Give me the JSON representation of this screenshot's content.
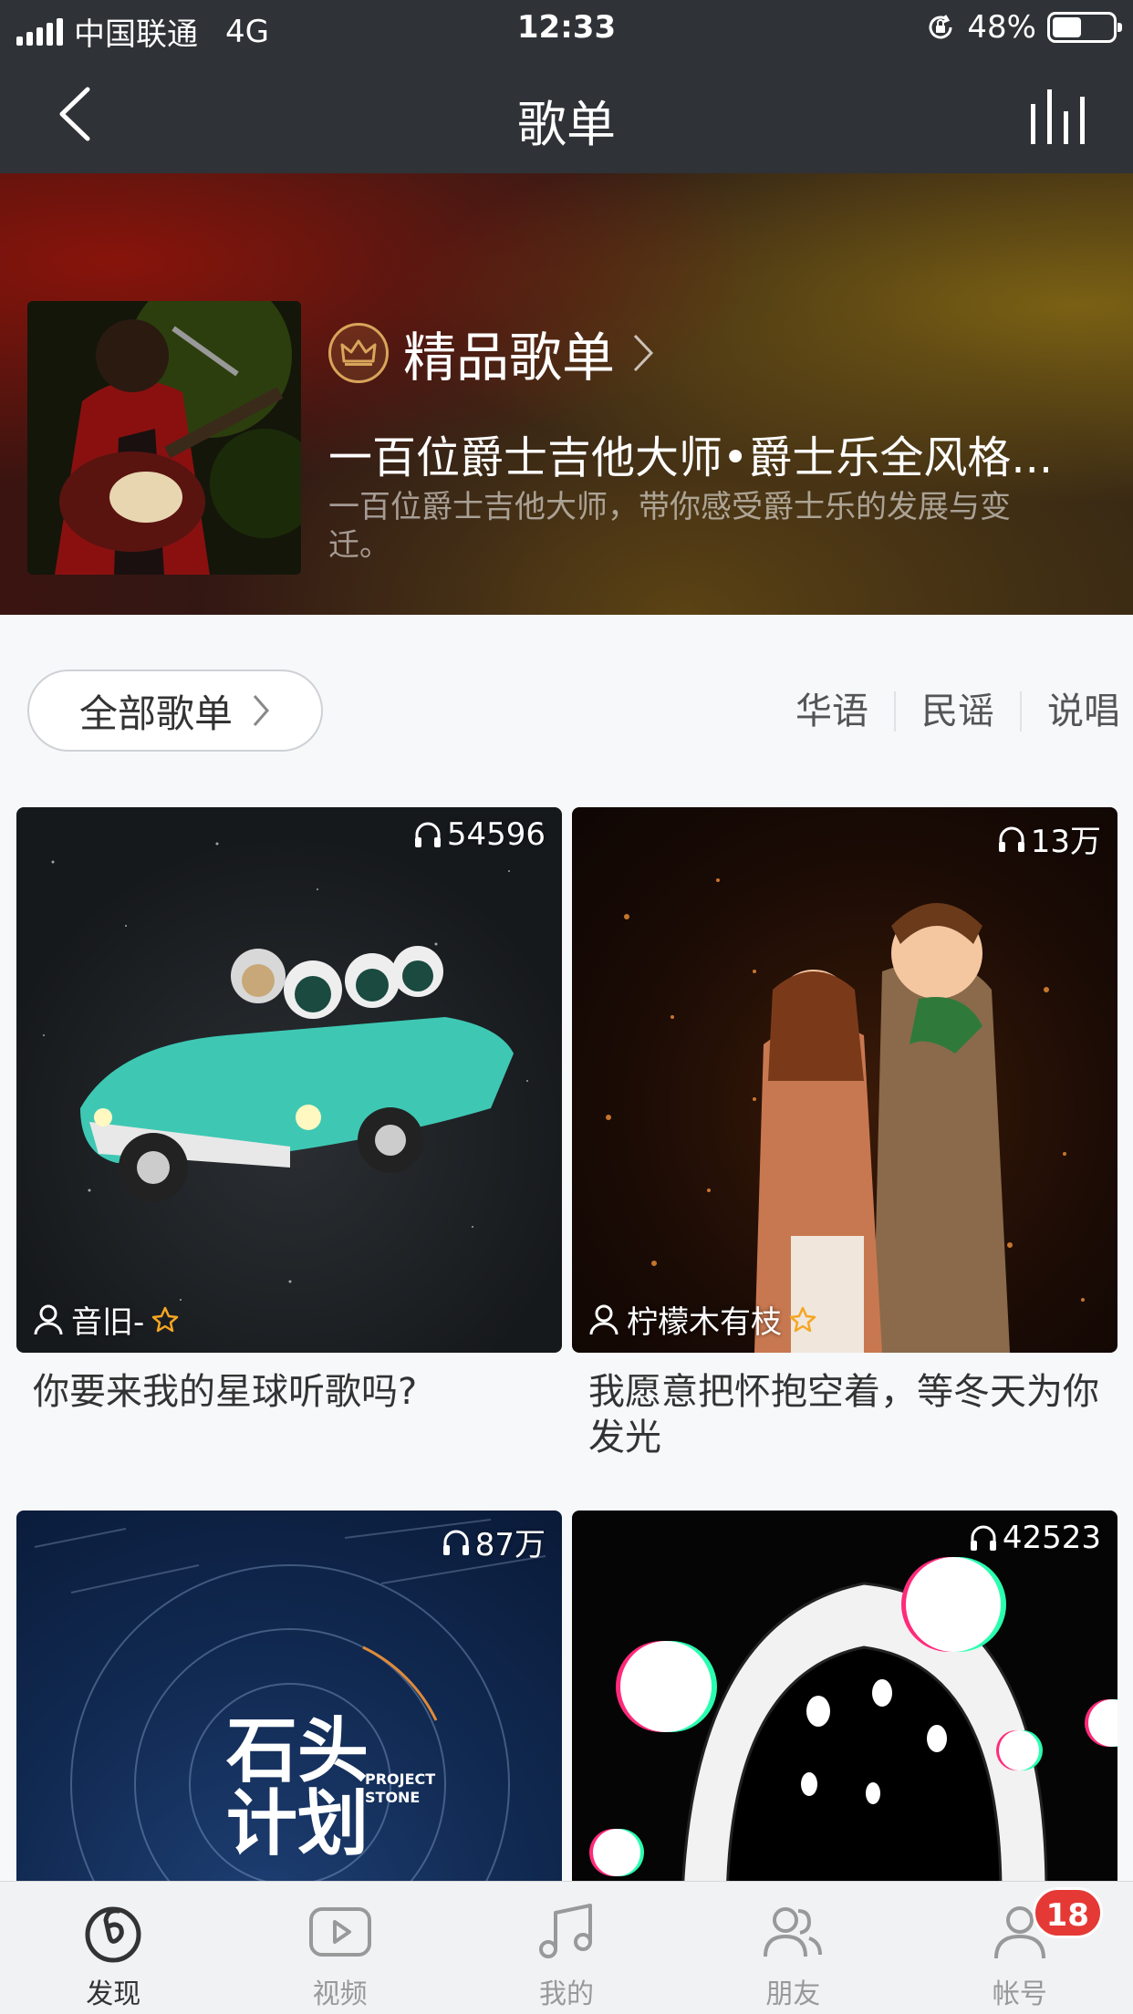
{
  "status_bar": {
    "carrier": "中国联通",
    "network": "4G",
    "time": "12:33",
    "battery": "48%",
    "battery_level": 0.48
  },
  "nav": {
    "title": "歌单",
    "back_icon": "chevron-left-icon",
    "now_playing_icon": "equalizer-icon"
  },
  "featured": {
    "badge": "精品歌单",
    "title": "一百位爵士吉他大师•爵士乐全风格...",
    "description": "一百位爵士吉他大师，带你感受爵士乐的发展与变迁。"
  },
  "filters": {
    "all_label": "全部歌单",
    "tags": [
      "华语",
      "民谣",
      "说唱"
    ]
  },
  "playlists": [
    {
      "play_count": "54596",
      "creator": "音旧-",
      "title": "你要来我的星球听歌吗?"
    },
    {
      "play_count": "13万",
      "creator": "柠檬木有枝",
      "title": "我愿意把怀抱空着，等冬天为你发光"
    },
    {
      "play_count": "87万",
      "creator": "",
      "title": ""
    },
    {
      "play_count": "42523",
      "creator": "",
      "title": ""
    }
  ],
  "tabbar": {
    "tabs": [
      {
        "label": "发现",
        "icon": "netease-music-icon"
      },
      {
        "label": "视频",
        "icon": "video-play-icon"
      },
      {
        "label": "我的",
        "icon": "music-note-icon"
      },
      {
        "label": "朋友",
        "icon": "friends-icon"
      },
      {
        "label": "帐号",
        "icon": "account-icon"
      }
    ],
    "account_badge": "18"
  },
  "colors": {
    "header_bg": "#2f3236",
    "badge_red": "#e53935",
    "crown_gold": "#d8a55a",
    "vip_star": "#f5a623"
  }
}
